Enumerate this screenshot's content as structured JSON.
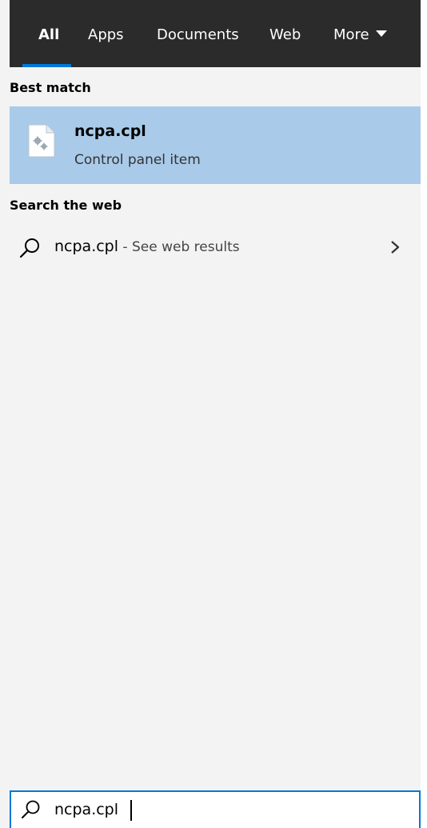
{
  "tabs": [
    {
      "label": "All",
      "active": true
    },
    {
      "label": "Apps",
      "active": false
    },
    {
      "label": "Documents",
      "active": false
    },
    {
      "label": "Web",
      "active": false
    },
    {
      "label": "More",
      "active": false
    }
  ],
  "sections": {
    "best_match": {
      "header": "Best match",
      "item": {
        "title": "ncpa.cpl",
        "subtitle": "Control panel item",
        "icon": "control-panel-file-icon"
      }
    },
    "search_web": {
      "header": "Search the web",
      "result": {
        "query": "ncpa.cpl",
        "suffix": " - See web results",
        "icon": "search-icon"
      }
    }
  },
  "search_box": {
    "value": "ncpa.cpl",
    "icon": "search-icon"
  },
  "colors": {
    "tab_bar_bg": "#2b2b2b",
    "accent": "#0078d7",
    "selected_item_bg": "#a9cbe9",
    "panel_bg": "#f3f3f3"
  }
}
